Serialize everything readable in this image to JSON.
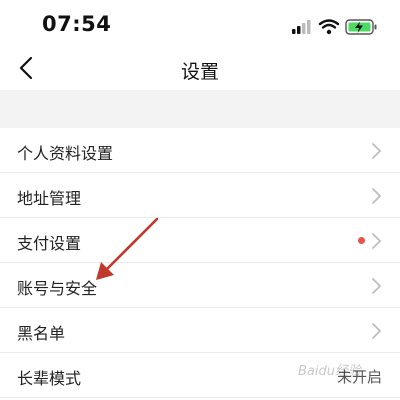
{
  "status_bar": {
    "time": "07:54",
    "icons": [
      "signal-icon",
      "wifi-icon",
      "battery-charging-icon"
    ],
    "battery_color": "#4cd964"
  },
  "nav": {
    "title": "设置",
    "back_icon": "chevron-left-icon"
  },
  "settings": {
    "items": [
      {
        "label": "个人资料设置"
      },
      {
        "label": "地址管理"
      },
      {
        "label": "支付设置",
        "badge_color": "#e5534b"
      },
      {
        "label": "账号与安全"
      },
      {
        "label": "黑名单"
      },
      {
        "label": "长辈模式",
        "value": "未开启"
      }
    ]
  },
  "annotation": {
    "color": "#c0392b"
  },
  "watermark": "Baidu经验"
}
